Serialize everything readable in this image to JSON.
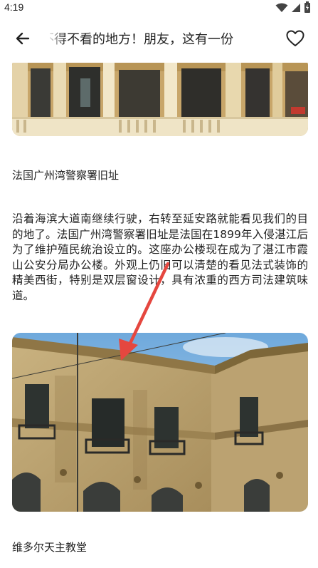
{
  "status_bar": {
    "time": "4:19",
    "icons": [
      "wifi-icon",
      "signal-icon",
      "battery-icon"
    ]
  },
  "app_bar": {
    "title": "不得不看的地方！朋友，这有一份",
    "back_icon": "arrow-left-icon",
    "favorite_icon": "heart-outline-icon"
  },
  "article": {
    "caption_1": "法国广州湾警察署旧址",
    "paragraph": "沿着海滨大道南继续行驶，右转至延安路就能看见我们的目的地了。法国广州湾警察署旧址是法国在1899年入侵湛江后为了维护殖民统治设立的。这座办公楼现在成为了湛江市霞山公安分局办公楼。外观上仍旧可以清楚的看见法式装饰的精美西街，特别是双层窗设计，具有浓重的西方司法建筑味道。",
    "caption_2": "维多尔天主教堂"
  },
  "colors": {
    "annotation_arrow": "#e5473f",
    "text": "#222222"
  }
}
